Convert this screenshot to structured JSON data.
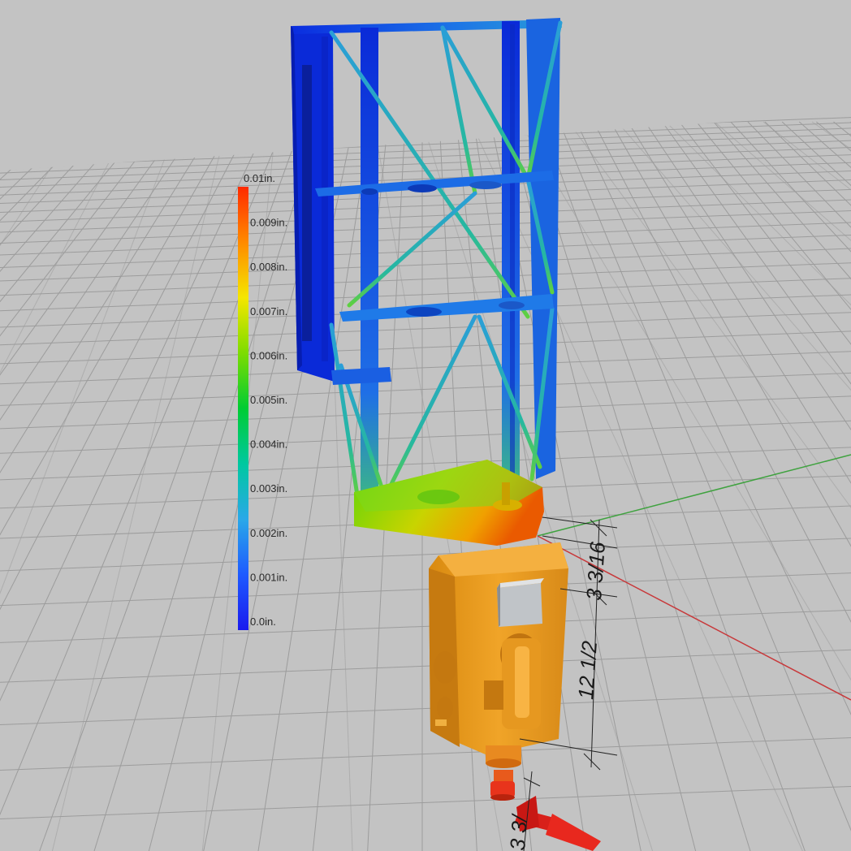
{
  "viewport": {
    "background_color": "#c3c3c3",
    "grid_color": "#9c9c9c",
    "x_axis_color": "#c8383a",
    "y_axis_color": "#3fa23f"
  },
  "legend": {
    "labels": [
      "0.01in.",
      "0.009in.",
      "0.008in.",
      "0.007in.",
      "0.006in.",
      "0.005in.",
      "0.004in.",
      "0.003in.",
      "0.002in.",
      "0.001in.",
      "0.0in."
    ],
    "gradient_colors": [
      "#ff2a00",
      "#ff8a00",
      "#f5e600",
      "#7ddc00",
      "#00cc33",
      "#00c8a0",
      "#2aa8e8",
      "#1e5aff",
      "#1a1aee"
    ]
  },
  "dimensions": {
    "upper": "3 3/16",
    "middle": "12 1/2",
    "lower": "3 3/"
  },
  "model": {
    "frame_colors": [
      "#0a2de0",
      "#1c74e6",
      "#2aa8d8"
    ],
    "base_colors": [
      "#5fd40a",
      "#c8d400",
      "#f0a000",
      "#ea5a00"
    ],
    "body_color": "#e89a1c",
    "tip_color": "#e8341c",
    "motor_color": "#c0c4c8"
  }
}
